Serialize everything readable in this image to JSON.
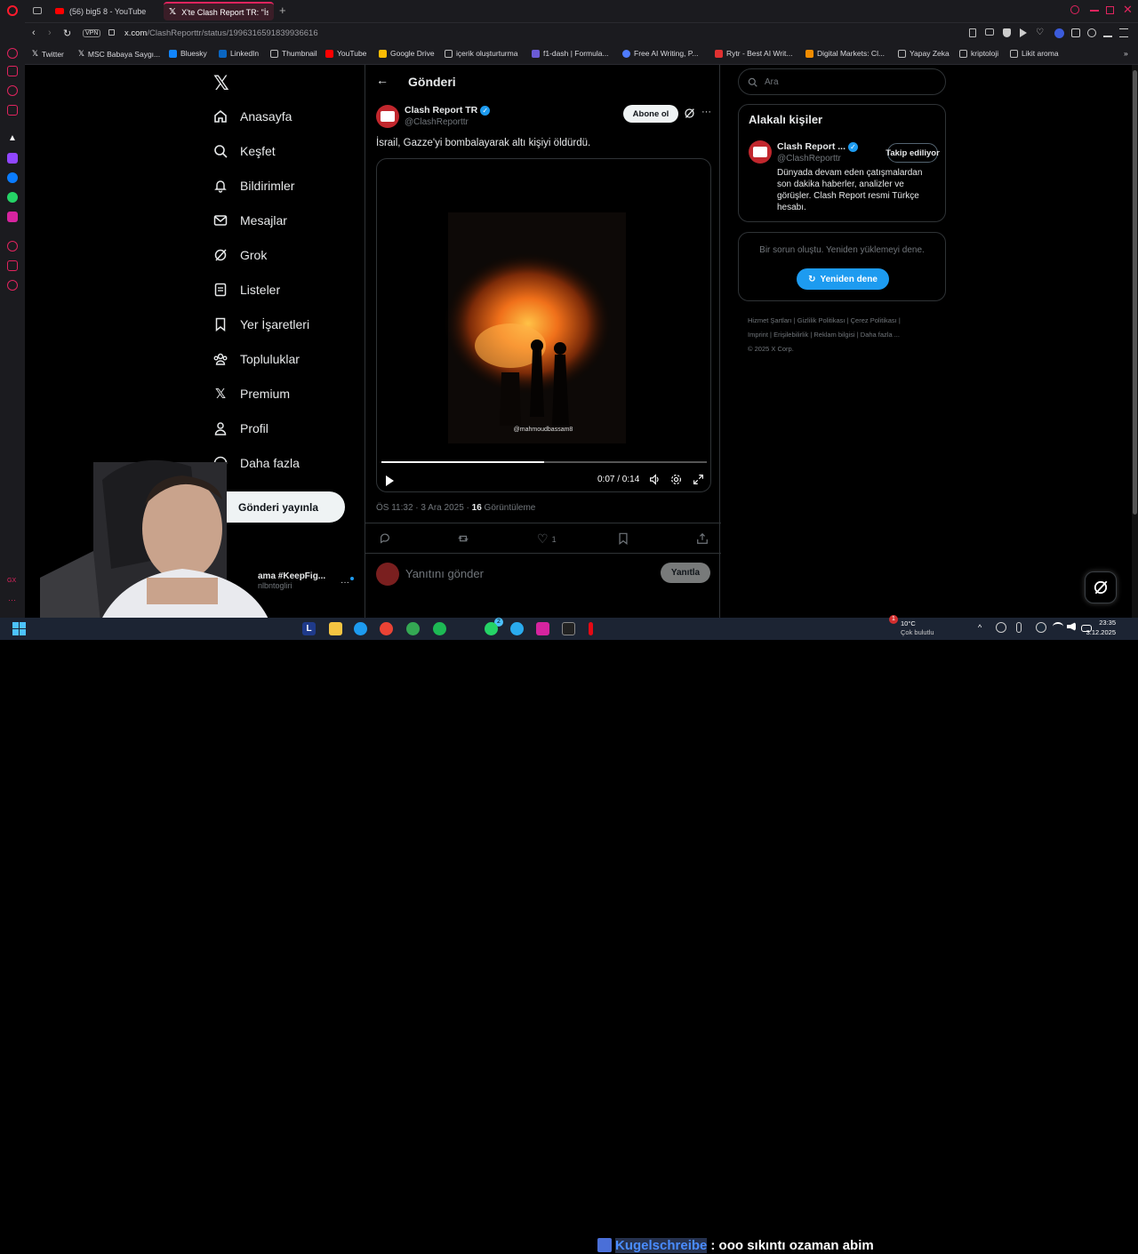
{
  "browser": {
    "tabs": [
      {
        "label": "(56) big5 8 - YouTube"
      },
      {
        "label": "X'te Clash Report TR: \"İsr"
      }
    ],
    "url": {
      "domain": "x.com",
      "path": "/ClashReporttr/status/1996316591839936616"
    },
    "vpn_label": "VPN",
    "bookmarks": [
      {
        "label": "Twitter"
      },
      {
        "label": "MSC Babaya Saygı..."
      },
      {
        "label": "Bluesky"
      },
      {
        "label": "LinkedIn"
      },
      {
        "label": "Thumbnail"
      },
      {
        "label": "YouTube"
      },
      {
        "label": "Google Drive"
      },
      {
        "label": "içerik oluşturturma"
      },
      {
        "label": "f1-dash | Formula..."
      },
      {
        "label": "Free AI Writing, P..."
      },
      {
        "label": "Rytr - Best AI Writ..."
      },
      {
        "label": "Digital Markets: Cl..."
      },
      {
        "label": "Yapay Zeka"
      },
      {
        "label": "kriptoloji"
      },
      {
        "label": "Likit aroma"
      }
    ]
  },
  "nav": {
    "items": [
      {
        "label": "Anasayfa",
        "icon": "home-icon"
      },
      {
        "label": "Keşfet",
        "icon": "search-icon"
      },
      {
        "label": "Bildirimler",
        "icon": "bell-icon"
      },
      {
        "label": "Mesajlar",
        "icon": "mail-icon"
      },
      {
        "label": "Grok",
        "icon": "grok-icon"
      },
      {
        "label": "Listeler",
        "icon": "list-icon"
      },
      {
        "label": "Yer İşaretleri",
        "icon": "bookmark-icon"
      },
      {
        "label": "Topluluklar",
        "icon": "communities-icon"
      },
      {
        "label": "Premium",
        "icon": "x-logo-icon"
      },
      {
        "label": "Profil",
        "icon": "profile-icon"
      },
      {
        "label": "Daha fazla",
        "icon": "more-circle-icon"
      }
    ],
    "post_button": "Gönderi yayınla",
    "account": {
      "name": "ama #KeepFig...",
      "handle": "nlbntogliri"
    }
  },
  "post": {
    "header_title": "Gönderi",
    "author_name": "Clash Report TR",
    "author_handle": "@ClashReporttr",
    "subscribe_label": "Abone ol",
    "text": "İsrail, Gazze'yi bombalayarak altı kişiyi öldürdü.",
    "video": {
      "watermark": "@mahmoudbassam8",
      "time": "0:07 / 0:14",
      "progress": 0.5
    },
    "meta_time": "ÖS 11:32 · 3 Ara 2025 · ",
    "views_count": "16",
    "views_label": " Görüntüleme",
    "likes": "1",
    "reply_placeholder": "Yanıtını gönder",
    "reply_button": "Yanıtla"
  },
  "search": {
    "placeholder": "Ara"
  },
  "related": {
    "title": "Alakalı kişiler",
    "name": "Clash Report ...",
    "handle": "@ClashReporttr",
    "follow_label": "Takip ediliyor",
    "bio": "Dünyada devam eden çatışmalardan son dakika haberler, analizler ve görüşler. Clash Report resmi Türkçe hesabı."
  },
  "error_card": {
    "message": "Bir sorun oluştu. Yeniden yüklemeyi dene.",
    "retry": "Yeniden dene"
  },
  "footer": {
    "links": [
      "Hizmet Şartları",
      "Gizlilik Politikası",
      "Çerez Politikası",
      "Imprint",
      "Erişilebilirlik",
      "Reklam bilgisi",
      "Daha fazla ..."
    ],
    "copyright": "© 2025 X Corp."
  },
  "stream_overlay": {
    "username": "Kugelschreibe",
    "message": ": ooo sıkıntı ozaman abim"
  },
  "taskbar": {
    "weather_temp": "10°C",
    "weather_desc": "Çok bulutlu",
    "time": "23:35",
    "date": "3.12.2025",
    "notification_count": "1",
    "badge_count": "2"
  },
  "colors": {
    "accent_blue": "#1d9bf0",
    "brand_red": "#c1272d",
    "opera_red": "#ff1b2d"
  }
}
